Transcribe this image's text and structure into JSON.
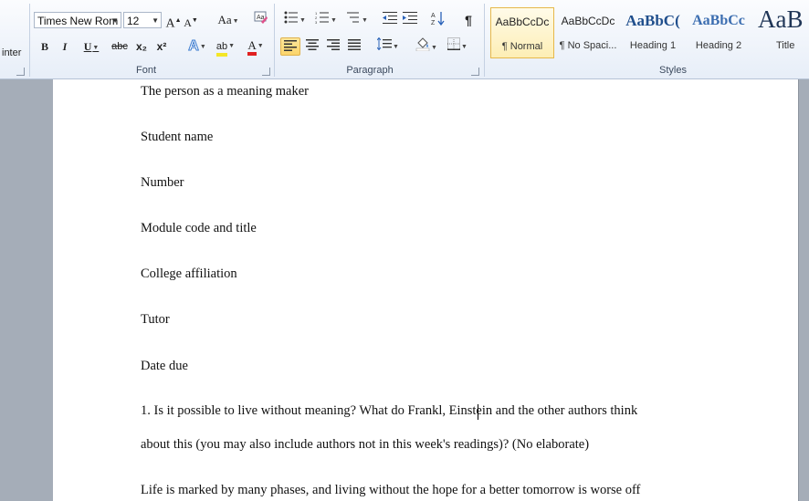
{
  "ribbon": {
    "clipboard_partial": "inter",
    "font": {
      "group_label": "Font",
      "font_name": "Times New Rom",
      "font_size": "12",
      "bold": "B",
      "italic": "I",
      "underline": "U",
      "strike": "abc",
      "subscript": "x₂",
      "superscript": "x²",
      "case": "Aa",
      "grow": "A",
      "shrink": "A",
      "highlight": "ab",
      "font_color": "A"
    },
    "paragraph": {
      "group_label": "Paragraph",
      "pilcrow": "¶"
    },
    "styles": {
      "group_label": "Styles",
      "items": [
        {
          "sample": "AaBbCcDc",
          "name": "¶ Normal"
        },
        {
          "sample": "AaBbCcDc",
          "name": "¶ No Spaci..."
        },
        {
          "sample": "AaBbC(",
          "name": "Heading 1"
        },
        {
          "sample": "AaBbCc",
          "name": "Heading 2"
        },
        {
          "sample": "AaB",
          "name": "Title"
        }
      ]
    }
  },
  "document": {
    "paragraphs": [
      "The person as a meaning maker",
      "Student name",
      "Number",
      "Module code and title",
      "College affiliation",
      "Tutor",
      "Date due",
      "1. Is it possible  to live without meaning?   What do Frankl, Einstein and the other authors think",
      "about this (you may also include authors not in this week's readings)? (No elaborate)",
      "Life is marked by many phases, and living  without the hope for a better tomorrow is worse off"
    ]
  },
  "colors": {
    "highlight": "#f4e626",
    "font_color": "#e02020",
    "heading": "#1f4e8c",
    "heading2": "#3b6db0"
  }
}
